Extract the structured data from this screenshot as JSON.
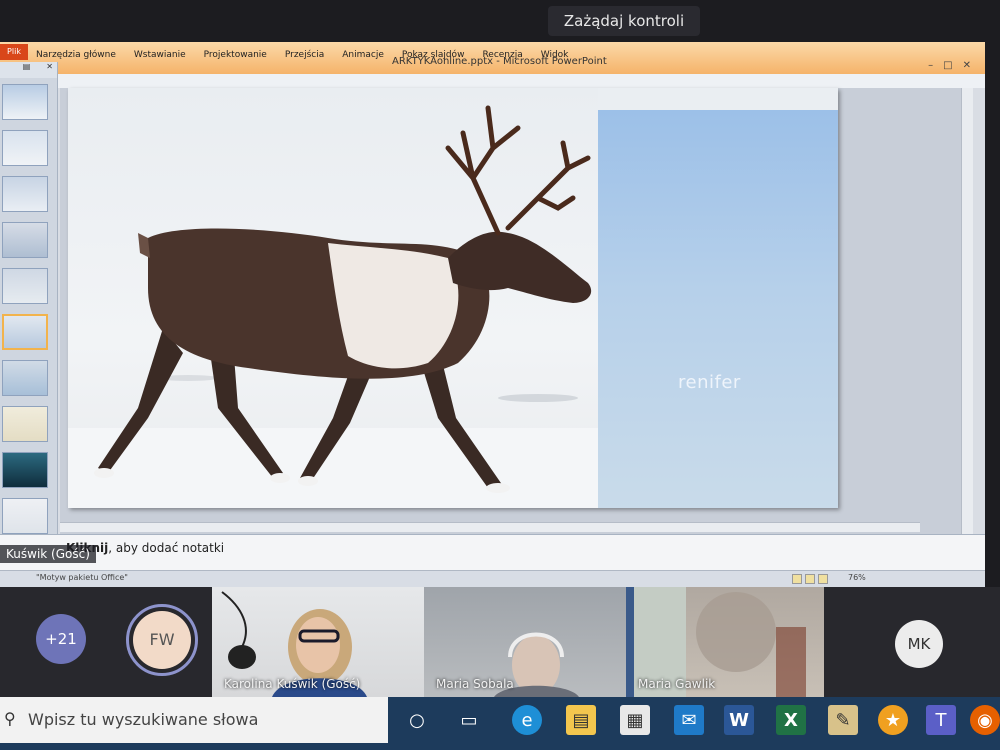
{
  "control_bar": {
    "request_control_label": "Zażądaj kontroli"
  },
  "powerpoint": {
    "file_tab": "Plik",
    "ribbon_tabs": [
      "Narzędzia główne",
      "Wstawianie",
      "Projektowanie",
      "Przejścia",
      "Animacje",
      "Pokaz slajdów",
      "Recenzja",
      "Widok"
    ],
    "window_title": "ARKTYKAonline.pptx - Microsoft PowerPoint",
    "slide": {
      "label": "renifer"
    },
    "notes_placeholder_bold": "Kliknij",
    "notes_placeholder_rest": ", aby dodać notatki",
    "status_theme": "\"Motyw pakietu Office\"",
    "zoom_percent": "76%"
  },
  "presenter_tag": "Kuświk (Gość)",
  "participants": {
    "overflow_count": "+21",
    "fw_initials": "FW",
    "mk_initials": "MK",
    "tiles": [
      {
        "name": "Karolina Kuświk (Gość)"
      },
      {
        "name": "Maria Sobala"
      },
      {
        "name": "Maria Gawlik"
      }
    ]
  },
  "taskbar": {
    "search_placeholder": "Wpisz tu wyszukiwane słowa"
  },
  "colors": {
    "ribbon_orange": "#f5b36a",
    "teams_purple": "#6e74b8",
    "taskbar_blue": "#1d3b5c"
  }
}
